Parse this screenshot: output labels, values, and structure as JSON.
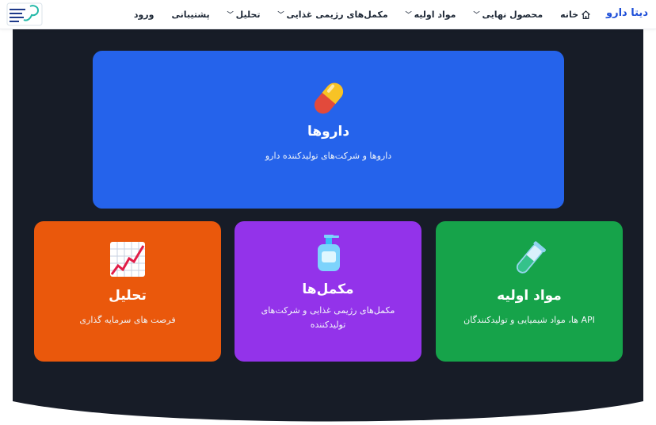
{
  "nav": {
    "brand": "دیتا دارو",
    "items": [
      {
        "label": "خانه",
        "icon": "home-icon"
      },
      {
        "label": "محصول نهایی",
        "dropdown": true
      },
      {
        "label": "مواد اولیه",
        "dropdown": true
      },
      {
        "label": "مکمل‌های رژیمی غذایی",
        "dropdown": true
      },
      {
        "label": "تحلیل",
        "dropdown": true
      },
      {
        "label": "پشتیبانی"
      },
      {
        "label": "ورود"
      }
    ]
  },
  "cards": {
    "drugs": {
      "title": "داروها",
      "desc": "داروها و شرکت‌های تولیدکننده دارو",
      "icon": "pill-icon",
      "color": "#2563eb"
    },
    "raw": {
      "title": "مواد اولیه",
      "desc": "API ها، مواد شیمیایی و تولیدکنندگان",
      "icon": "test-tube-icon",
      "color": "#16a34a"
    },
    "supplements": {
      "title": "مکمل‌ها",
      "desc": "مکمل‌های رژیمی غذایی و شرکت‌های تولیدکننده",
      "icon": "lotion-bottle-icon",
      "color": "#9333ea"
    },
    "analysis": {
      "title": "تحلیل",
      "desc": "فرصت های سرمایه گذاری",
      "icon": "chart-increasing-icon",
      "color": "#ea580c"
    }
  },
  "colors": {
    "hero_bg": "#171c27",
    "brand": "#1d4ed8"
  }
}
